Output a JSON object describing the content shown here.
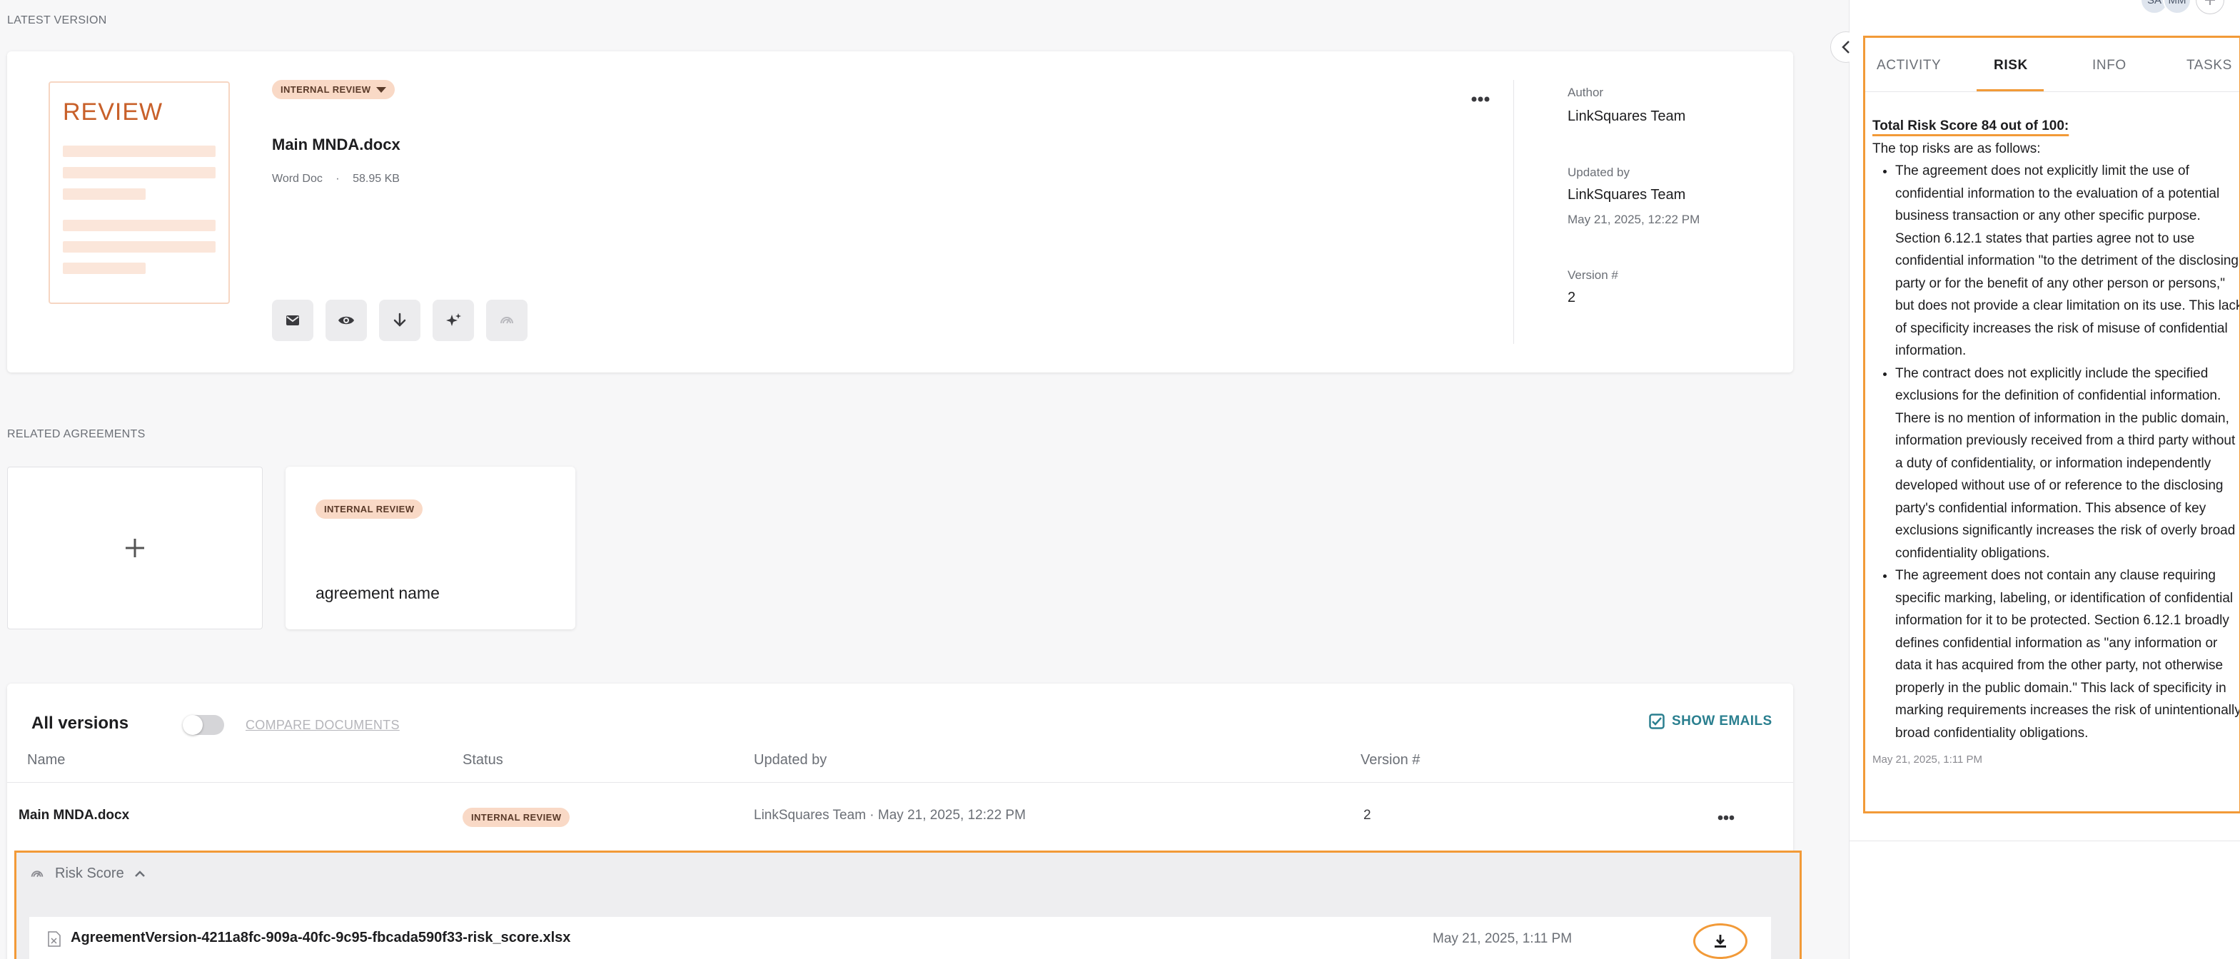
{
  "latest_version": {
    "section_label": "LATEST VERSION",
    "thumbnail_title": "REVIEW",
    "status_badge": "INTERNAL REVIEW",
    "doc_title": "Main MNDA.docx",
    "doc_type": "Word Doc",
    "doc_size": "58.95 KB",
    "author_label": "Author",
    "author_value": "LinkSquares Team",
    "updated_by_label": "Updated by",
    "updated_by_value": "LinkSquares Team",
    "updated_by_date": "May 21, 2025, 12:22 PM",
    "version_label": "Version #",
    "version_value": "2"
  },
  "related": {
    "section_label": "RELATED AGREEMENTS",
    "card_badge": "INTERNAL REVIEW",
    "card_name": "agreement name"
  },
  "versions": {
    "title": "All versions",
    "compare_label": "COMPARE DOCUMENTS",
    "show_emails_label": "SHOW EMAILS",
    "columns": [
      "Name",
      "Status",
      "Updated by",
      "Version #"
    ],
    "row": {
      "name": "Main MNDA.docx",
      "status": "INTERNAL REVIEW",
      "updated_by": "LinkSquares Team · May 21, 2025, 12:22 PM",
      "version": "2"
    },
    "risk_score_label": "Risk Score",
    "attachment": {
      "filename": "AgreementVersion-4211a8fc-909a-40fc-9c95-fbcada590f33-risk_score.xlsx",
      "date": "May 21, 2025, 1:11 PM"
    }
  },
  "right_panel": {
    "avatars": [
      "SA",
      "MM"
    ],
    "tabs": [
      "ACTIVITY",
      "RISK",
      "INFO",
      "TASKS"
    ],
    "active_tab": "RISK",
    "score_heading": "Total Risk Score 84 out of 100:",
    "intro": "The top risks are as follows:",
    "risks": [
      "The agreement does not explicitly limit the use of confidential information to the evaluation of a potential business transaction or any other specific purpose. Section 6.12.1 states that parties agree not to use confidential information \"to the detriment of the disclosing party or for the benefit of any other person or persons,\" but does not provide a clear limitation on its use. This lack of specificity increases the risk of misuse of confidential information.",
      "The contract does not explicitly include the specified exclusions for the definition of confidential information. There is no mention of information in the public domain, information previously received from a third party without a duty of confidentiality, or information independently developed without use of or reference to the disclosing party's confidential information. This absence of key exclusions significantly increases the risk of overly broad confidentiality obligations.",
      "The agreement does not contain any clause requiring specific marking, labeling, or identification of confidential information for it to be protected. Section 6.12.1 broadly defines confidential information as \"any information or data it has acquired from the other party, not otherwise properly in the public domain.\" This lack of specificity in marking requirements increases the risk of unintentionally broad confidentiality obligations."
    ],
    "timestamp": "May 21, 2025, 1:11 PM"
  },
  "colors": {
    "accent_orange": "#f29a38",
    "badge_bg": "#f9d9c6",
    "link_teal": "#2a7f8f"
  }
}
